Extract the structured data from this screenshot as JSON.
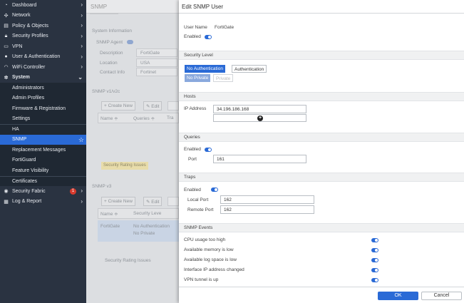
{
  "sidebar": {
    "items": [
      {
        "label": "Dashboard",
        "icon": "dashboard-icon"
      },
      {
        "label": "Network",
        "icon": "network-icon"
      },
      {
        "label": "Policy & Objects",
        "icon": "policy-icon"
      },
      {
        "label": "Security Profiles",
        "icon": "lock-icon"
      },
      {
        "label": "VPN",
        "icon": "monitor-icon"
      },
      {
        "label": "User & Authentication",
        "icon": "user-icon"
      },
      {
        "label": "WiFi Controller",
        "icon": "wifi-icon"
      },
      {
        "label": "System",
        "icon": "gear-icon"
      },
      {
        "label": "Administrators"
      },
      {
        "label": "Admin Profiles"
      },
      {
        "label": "Firmware & Registration"
      },
      {
        "label": "Settings"
      },
      {
        "label": "HA"
      },
      {
        "label": "SNMP"
      },
      {
        "label": "Replacement Messages"
      },
      {
        "label": "FortiGuard"
      },
      {
        "label": "Feature Visibility"
      },
      {
        "label": "Certificates"
      },
      {
        "label": "Security Fabric",
        "icon": "fabric-icon",
        "badge": "1"
      },
      {
        "label": "Log & Report",
        "icon": "chart-icon"
      }
    ]
  },
  "background": {
    "page_title": "SNMP",
    "system_information": "System Information",
    "snmp_agent": "SNMP Agent",
    "description_label": "Description",
    "description_value": "FortiGate",
    "location_label": "Location",
    "location_value": "USA",
    "contact_label": "Contact Info",
    "contact_value": "Fortinet",
    "v1v2c_title": "SNMP v1/v2c",
    "create_new": "+ Create New",
    "edit": "✎ Edit",
    "name_col": "Name ≑",
    "queries_col": "Queries ≑",
    "traps_col": "Tra",
    "security_rating": "Security Rating Issues",
    "v3_title": "SNMP v3",
    "security_level_col": "Security Leve",
    "row_name": "FortiGate",
    "row_level1": "No Authentication",
    "row_level2": "No Private",
    "security_rating2": "Security Rating Issues"
  },
  "panel": {
    "title": "Edit SNMP User",
    "user_name_label": "User Name",
    "user_name_value": "FortiGate",
    "enabled_label": "Enabled",
    "security_level": {
      "heading": "Security Level",
      "no_auth": "No Authentication",
      "auth": "Authentication",
      "no_private": "No Private",
      "private": "Private"
    },
    "hosts": {
      "heading": "Hosts",
      "ip_label": "IP Address",
      "ip_value": "34.196.186.168"
    },
    "queries": {
      "heading": "Queries",
      "enabled_label": "Enabled",
      "port_label": "Port",
      "port_value": "161"
    },
    "traps": {
      "heading": "Traps",
      "enabled_label": "Enabled",
      "local_port_label": "Local Port",
      "local_port_value": "162",
      "remote_port_label": "Remote Port",
      "remote_port_value": "162"
    },
    "events": {
      "heading": "SNMP Events",
      "items": [
        "CPU usage too high",
        "Available memory is low",
        "Available log space is low",
        "Interface IP address changed",
        "VPN tunnel is up"
      ]
    },
    "ok_label": "OK",
    "cancel_label": "Cancel"
  },
  "colors": {
    "sidebar_bg": "#2a3341",
    "accent": "#2a6ad6",
    "badge": "#d83b2e"
  }
}
